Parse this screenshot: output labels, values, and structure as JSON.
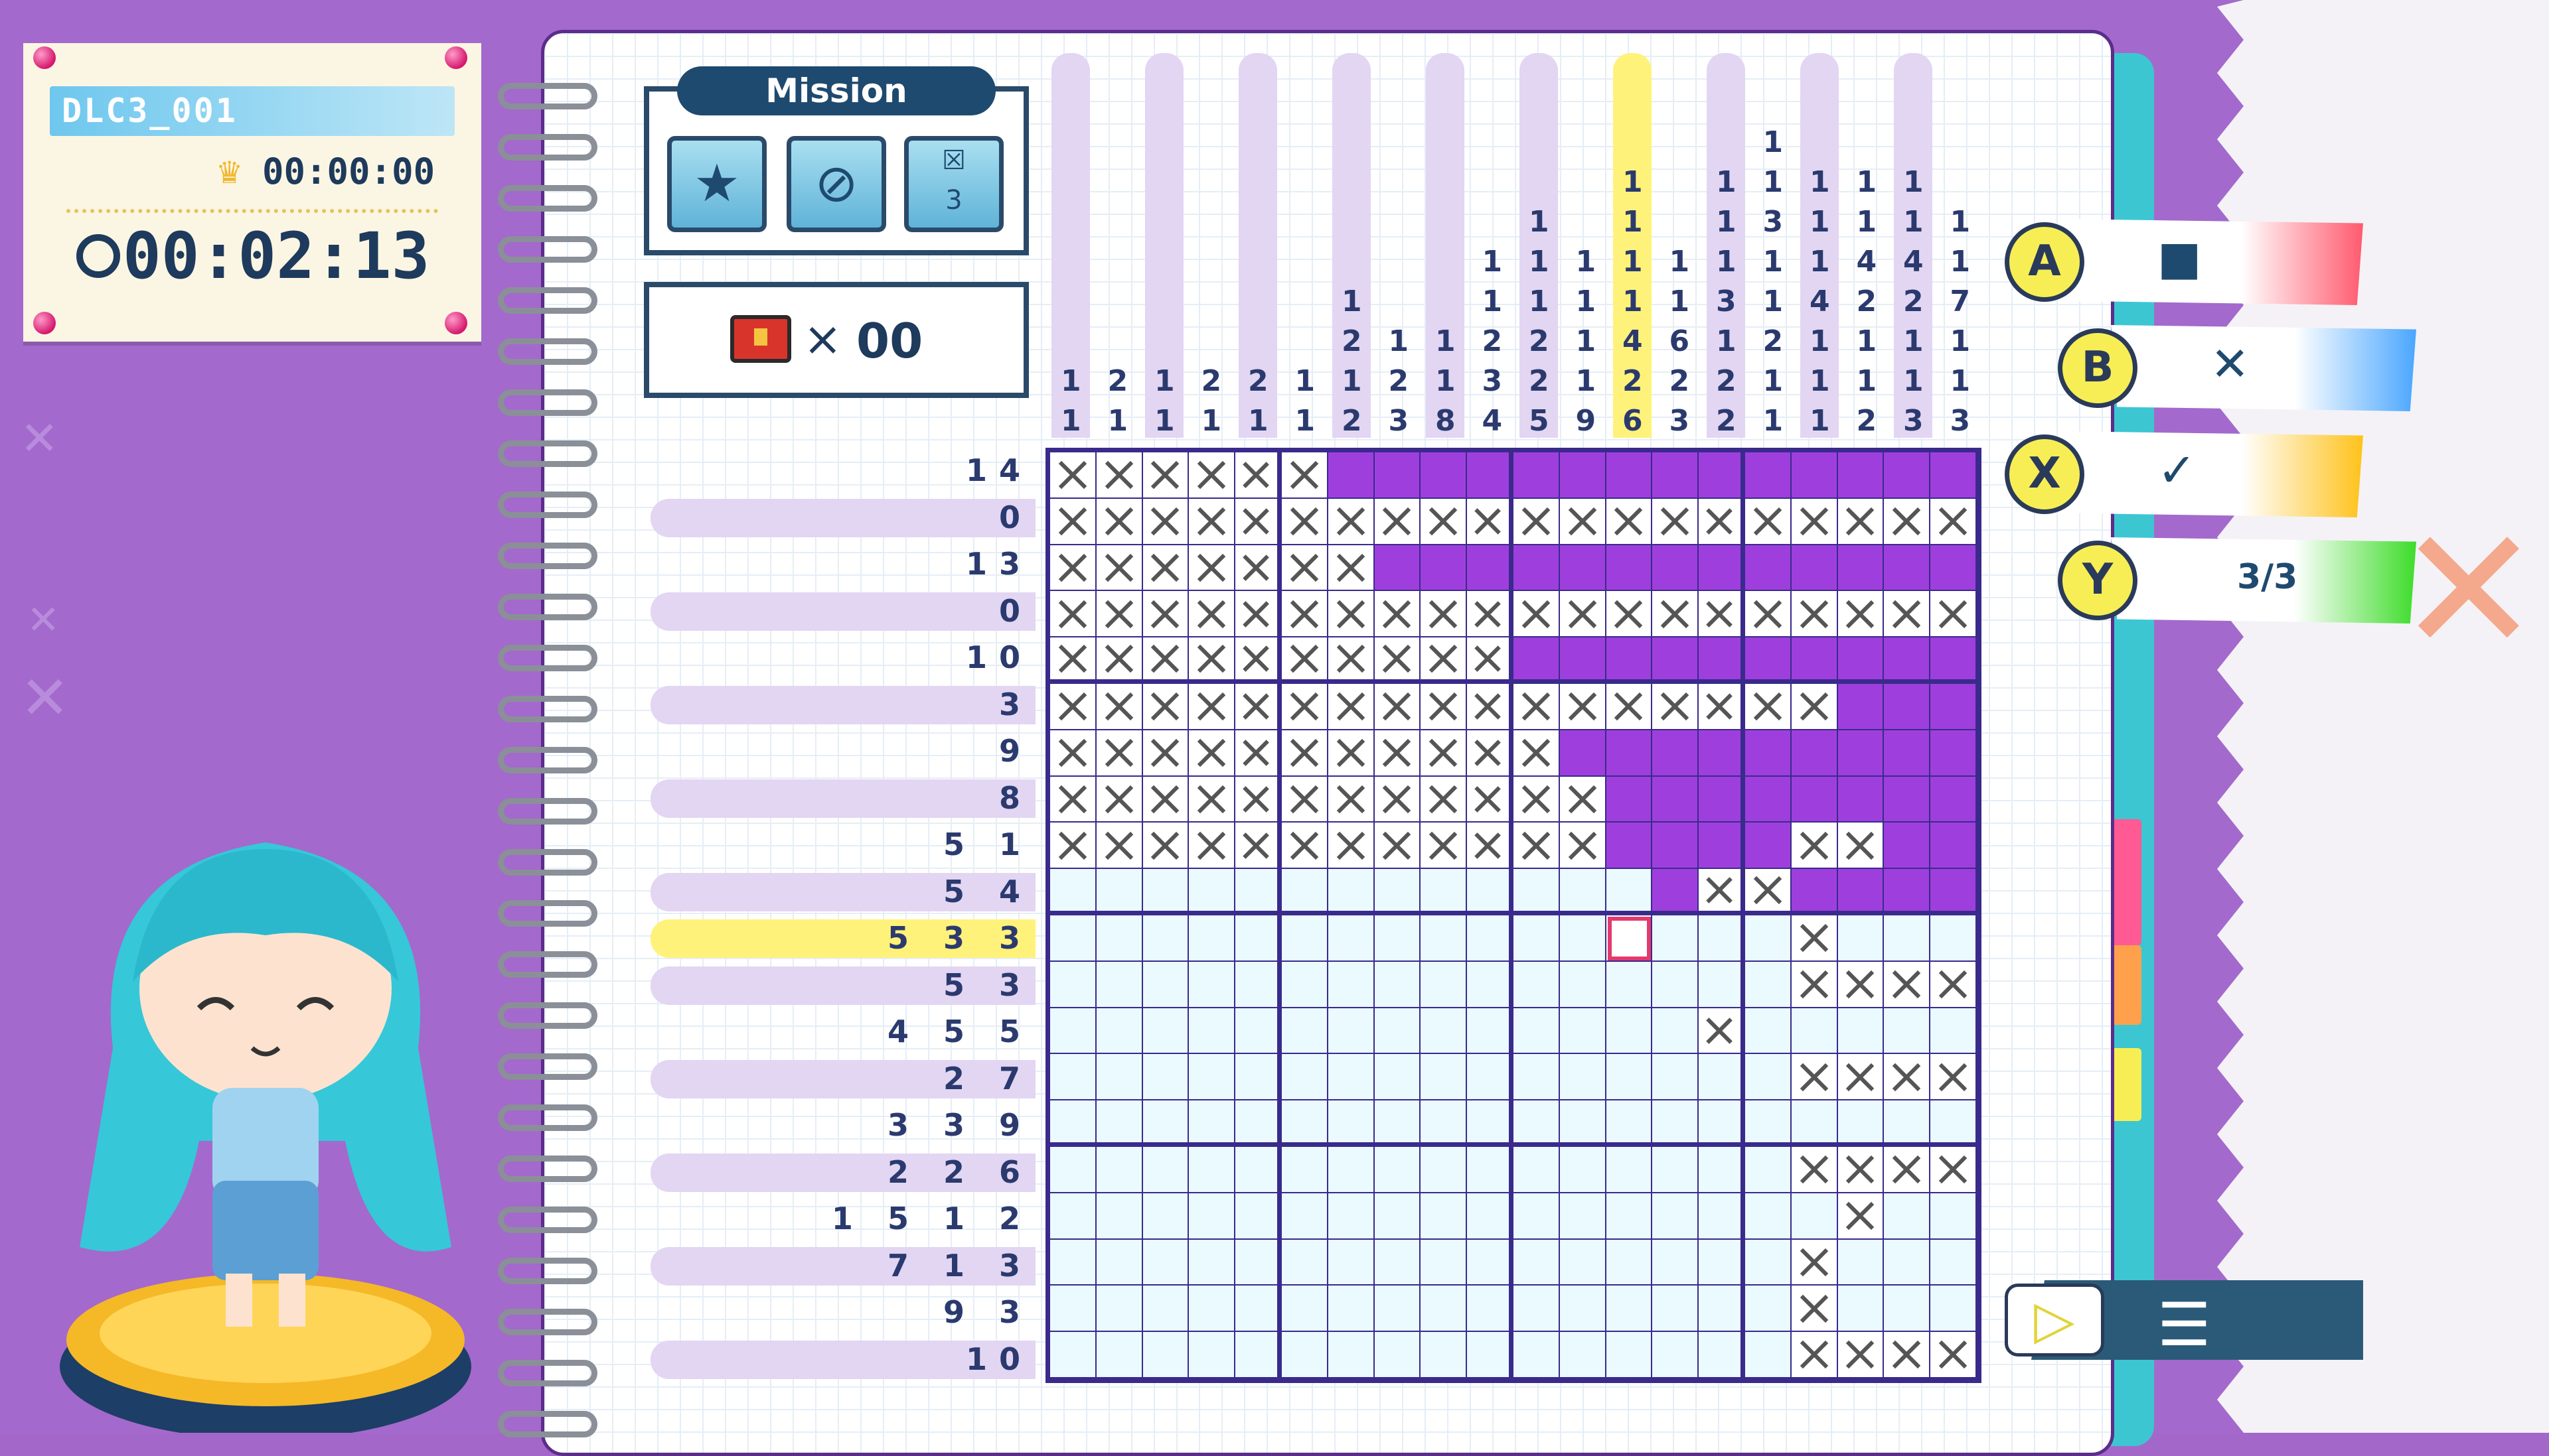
{
  "header": {
    "level_id": "DLC3_001",
    "best_time": "00:00:00",
    "elapsed_time": "00:02:13"
  },
  "mission": {
    "title": "Mission",
    "icons": [
      "star-medal-icon",
      "no-hint-icon",
      "mistake-limit-icon"
    ],
    "mistake_limit_badge": "3"
  },
  "treasure": {
    "icon": "treasure-chest-icon",
    "multiplier": "×",
    "count": "00"
  },
  "controls": [
    {
      "button": "A",
      "action_icon": "fill-square-icon",
      "label": "■",
      "accent": "#ff5a6e"
    },
    {
      "button": "B",
      "action_icon": "cross-mark-icon",
      "label": "✕",
      "accent": "#4aa6ff"
    },
    {
      "button": "X",
      "action_icon": "check-mark-icon",
      "label": "✓",
      "accent": "#ffc21a"
    },
    {
      "button": "Y",
      "action_icon": "hint-bulb-icon",
      "label": "3/3",
      "accent": "#3edc2a"
    }
  ],
  "column_clues": [
    [
      "1",
      "1"
    ],
    [
      "2",
      "1"
    ],
    [
      "1",
      "1"
    ],
    [
      "2",
      "1"
    ],
    [
      "2",
      "1"
    ],
    [
      "1",
      "1"
    ],
    [
      "1",
      "2",
      "1",
      "2"
    ],
    [
      "1",
      "2",
      "3"
    ],
    [
      "1",
      "1",
      "8"
    ],
    [
      "1",
      "1",
      "2",
      "3",
      "4"
    ],
    [
      "1",
      "1",
      "1",
      "2",
      "2",
      "5"
    ],
    [
      "1",
      "1",
      "1",
      "1",
      "9"
    ],
    [
      "1",
      "1",
      "1",
      "1",
      "4",
      "2",
      "6"
    ],
    [
      "1",
      "1",
      "6",
      "2",
      "3"
    ],
    [
      "1",
      "1",
      "1",
      "3",
      "1",
      "2",
      "2"
    ],
    [
      "1",
      "1",
      "3",
      "1",
      "1",
      "2",
      "1",
      "1"
    ],
    [
      "1",
      "1",
      "1",
      "4",
      "1",
      "1",
      "1"
    ],
    [
      "1",
      "1",
      "4",
      "2",
      "1",
      "1",
      "2"
    ],
    [
      "1",
      "1",
      "4",
      "2",
      "1",
      "1",
      "3"
    ],
    [
      "1",
      "1",
      "7",
      "1",
      "1",
      "3"
    ]
  ],
  "row_clues": [
    [
      "14"
    ],
    [
      "0"
    ],
    [
      "13"
    ],
    [
      "0"
    ],
    [
      "10"
    ],
    [
      "3"
    ],
    [
      "9"
    ],
    [
      "8"
    ],
    [
      "5",
      "1"
    ],
    [
      "5",
      "4"
    ],
    [
      "5",
      "3",
      "3"
    ],
    [
      "5",
      "3"
    ],
    [
      "4",
      "5",
      "5"
    ],
    [
      "2",
      "7"
    ],
    [
      "3",
      "3",
      "9"
    ],
    [
      "2",
      "2",
      "6"
    ],
    [
      "1",
      "5",
      "1",
      "2"
    ],
    [
      "7",
      "1",
      "3"
    ],
    [
      "9",
      "3"
    ],
    [
      "10"
    ]
  ],
  "grid_rows": [
    "xxxxxx..............",
    "xxxxxxxxxxxxxxxxxxxx",
    "xxxxxxx.............",
    "xxxxxxxxxxxxxxxxxxxx",
    "xxxxxxxxxx..........",
    "xxxxxxxxxxxxxxxxx...",
    "xxxxxxxxxxx.........",
    "xxxxxxxxxxxx........",
    "xxxxxxxxxxxx....xx..",
    "ccccccccccccc.xx....",
    "ccccccccccccccccxccc",
    "ccccccccccccccccxxxx",
    "ccccccccccccccxccccc",
    "ccccccccccccccccxxxx",
    "ccccccccccccccccccccc",
    "ccccccccccccccccxxxx",
    "cccccccccccccccccxcc",
    "ccccccccccccccccxccc",
    "ccccccccccccccccxccc",
    "ccccccccccccccccxxxx"
  ],
  "highlight": {
    "row": 10,
    "col": 12
  },
  "colors": {
    "fill": "#9e3fdd",
    "highlight": "#fff27a",
    "accent": "#e33a6e"
  }
}
